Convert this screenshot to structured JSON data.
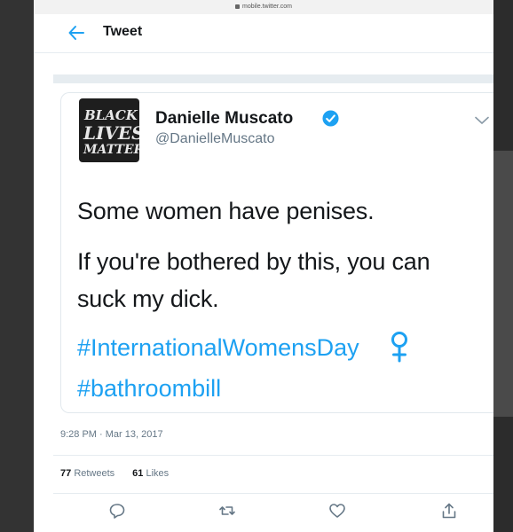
{
  "browser": {
    "url": "mobile.twitter.com"
  },
  "header": {
    "title": "Tweet"
  },
  "tweet": {
    "author": {
      "name": "Danielle Muscato",
      "handle": "@DanielleMuscato",
      "avatar_text": [
        "BLACK",
        "LIVES",
        "MATTER"
      ],
      "verified": true
    },
    "lines": [
      "Some women have penises.",
      "If you're bothered by this, you can",
      "suck my dick."
    ],
    "hashtags": [
      "#InternationalWomensDay",
      "#bathroombill"
    ],
    "emoji": "female-sign",
    "timestamp": "9:28 PM · Mar 13, 2017",
    "retweets": {
      "count": "77",
      "label": "Retweets"
    },
    "likes": {
      "count": "61",
      "label": "Likes"
    }
  },
  "actions": [
    "reply-icon",
    "retweet-icon",
    "like-icon",
    "share-icon"
  ],
  "colors": {
    "link": "#1da1f2",
    "text": "#14171a",
    "muted": "#657786",
    "verified": "#1da1f2"
  }
}
